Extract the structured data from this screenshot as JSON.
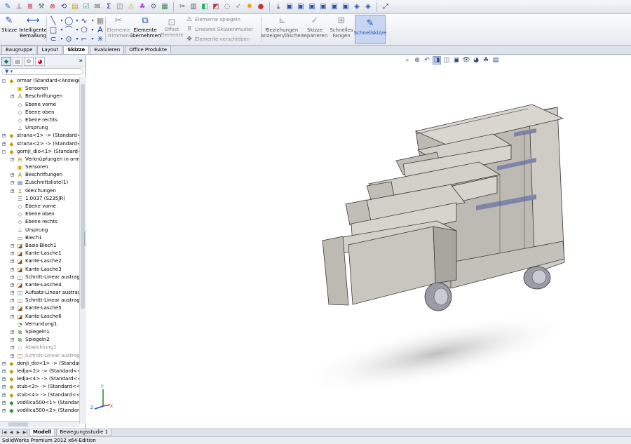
{
  "ribbon": {
    "skizze": "Skizze",
    "bemassung": "Intelligente\nBemaßung",
    "trimmen": "Elemente\ntrimmen",
    "uebernehmen": "Elemente\nübernehmen",
    "offset": "Offset\nElemente",
    "spiegeln": "Elemente spiegeln",
    "muster": "Lineares Skizzenmuster",
    "verschieben": "Elemente verschieben",
    "beziehungen": "Beziehungen\nanzeigen/löschen",
    "reparieren": "Skizze\nreparieren",
    "fangen": "Schnelles\nFangen",
    "schnellskizze": "Schnellskizze"
  },
  "tabs": [
    "Baugruppe",
    "Layout",
    "Skizze",
    "Evaluieren",
    "Office Produkte"
  ],
  "tree": [
    {
      "label": "ormar  (Standard<Anzeigestat",
      "icon": "assembly-icon",
      "level": 0,
      "exp": "-"
    },
    {
      "label": "Sensoren",
      "icon": "sensor-folder-icon",
      "level": 1,
      "exp": ""
    },
    {
      "label": "Beschriftungen",
      "icon": "annotation-icon",
      "level": 1,
      "exp": "+"
    },
    {
      "label": "Ebene vorne",
      "icon": "plane-icon",
      "level": 1,
      "exp": ""
    },
    {
      "label": "Ebene oben",
      "icon": "plane-icon",
      "level": 1,
      "exp": ""
    },
    {
      "label": "Ebene rechts",
      "icon": "plane-icon",
      "level": 1,
      "exp": ""
    },
    {
      "label": "Ursprung",
      "icon": "origin-icon",
      "level": 1,
      "exp": ""
    },
    {
      "label": "strana<1> -> (Standard<<",
      "icon": "part-icon",
      "level": 0,
      "exp": "+"
    },
    {
      "label": "strana<2> -> (Standard<<",
      "icon": "part-icon",
      "level": 0,
      "exp": "+"
    },
    {
      "label": "gornji_dio<1> (Standard<",
      "icon": "part-icon",
      "level": 0,
      "exp": "-"
    },
    {
      "label": "Verknüpfungen in orm",
      "icon": "mates-icon",
      "level": 1,
      "exp": "+"
    },
    {
      "label": "Sensoren",
      "icon": "sensor-folder-icon",
      "level": 1,
      "exp": ""
    },
    {
      "label": "Beschriftungen",
      "icon": "annotation-icon",
      "level": 1,
      "exp": "+"
    },
    {
      "label": "Zuschnittsliste(1)",
      "icon": "cutlist-icon",
      "level": 1,
      "exp": "+"
    },
    {
      "label": "Gleichungen",
      "icon": "equations-icon",
      "level": 1,
      "exp": "+"
    },
    {
      "label": "1.0037 (S235JR)",
      "icon": "material-icon",
      "level": 1,
      "exp": ""
    },
    {
      "label": "Ebene vorne",
      "icon": "plane-icon",
      "level": 1,
      "exp": ""
    },
    {
      "label": "Ebene oben",
      "icon": "plane-icon",
      "level": 1,
      "exp": ""
    },
    {
      "label": "Ebene rechts",
      "icon": "plane-icon",
      "level": 1,
      "exp": ""
    },
    {
      "label": "Ursprung",
      "icon": "origin-icon",
      "level": 1,
      "exp": ""
    },
    {
      "label": "Blech1",
      "icon": "sheetmetal-icon",
      "level": 1,
      "exp": ""
    },
    {
      "label": "Basis-Blech1",
      "icon": "feature-icon",
      "level": 1,
      "exp": "+"
    },
    {
      "label": "Kante-Lasche1",
      "icon": "feature-icon",
      "level": 1,
      "exp": "+"
    },
    {
      "label": "Kante-Lasche2",
      "icon": "feature-icon",
      "level": 1,
      "exp": "+"
    },
    {
      "label": "Kante-Lasche3",
      "icon": "feature-icon",
      "level": 1,
      "exp": "+"
    },
    {
      "label": "Schnitt-Linear austrag",
      "icon": "cut-icon",
      "level": 1,
      "exp": "+"
    },
    {
      "label": "Kante-Lasche4",
      "icon": "feature-icon",
      "level": 1,
      "exp": "+"
    },
    {
      "label": "Aufsatz-Linear austrag",
      "icon": "extrude-icon",
      "level": 1,
      "exp": "+"
    },
    {
      "label": "Schnitt-Linear austrag",
      "icon": "cut-icon",
      "level": 1,
      "exp": "+"
    },
    {
      "label": "Kante-Lasche5",
      "icon": "feature-icon",
      "level": 1,
      "exp": "+"
    },
    {
      "label": "Kante-Lasche6",
      "icon": "feature-icon",
      "level": 1,
      "exp": "+"
    },
    {
      "label": "Verrundung1",
      "icon": "fillet-icon",
      "level": 1,
      "exp": ""
    },
    {
      "label": "Spiegeln1",
      "icon": "mirror-icon",
      "level": 1,
      "exp": "+"
    },
    {
      "label": "Spiegeln2",
      "icon": "mirror-icon",
      "level": 1,
      "exp": "+"
    },
    {
      "label": "Abwicklung1",
      "icon": "flatpattern-icon",
      "level": 1,
      "exp": "+",
      "gray": true
    },
    {
      "label": "Schnitt-Linear austrag",
      "icon": "cut-icon",
      "level": 1,
      "exp": "+",
      "gray": true
    },
    {
      "label": "donji_dio<1> -> (Standard",
      "icon": "part-icon",
      "level": 0,
      "exp": "+"
    },
    {
      "label": "ledja<2> -> (Standard<<S",
      "icon": "part-icon",
      "level": 0,
      "exp": "+"
    },
    {
      "label": "ledja<4> -> (Standard<<S",
      "icon": "part-icon",
      "level": 0,
      "exp": "+"
    },
    {
      "label": "stub<3> -> (Standard<<S",
      "icon": "part-icon",
      "level": 0,
      "exp": "+"
    },
    {
      "label": "stub<4> -> (Standard<<S",
      "icon": "part-icon",
      "level": 0,
      "exp": "+"
    },
    {
      "label": "vodilica500<1> (Standard",
      "icon": "subassembly-icon",
      "level": 0,
      "exp": "+"
    },
    {
      "label": "vodilica500<2> (Standard",
      "icon": "subassembly-icon",
      "level": 0,
      "exp": "+"
    }
  ],
  "bottom_tabs": [
    "Modell",
    "Bewegungsstudie 1"
  ],
  "status": "SolidWorks Premium 2012 x64-Edition",
  "colors": {
    "metal": "#c9c6c0",
    "metal_dark": "#8f8c87",
    "edge": "#3a3a3a",
    "rail": "#7d86a8",
    "wheel": "#9a9ba6"
  }
}
